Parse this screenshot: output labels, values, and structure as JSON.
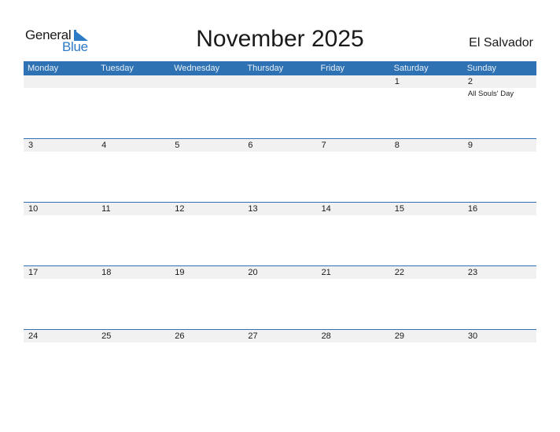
{
  "logo": {
    "word1": "General",
    "word2": "Blue",
    "brand_color": "#2c7bc4"
  },
  "title": "November 2025",
  "country": "El Salvador",
  "header_color": "#2e72b3",
  "days_of_week": [
    "Monday",
    "Tuesday",
    "Wednesday",
    "Thursday",
    "Friday",
    "Saturday",
    "Sunday"
  ],
  "weeks": [
    [
      {
        "day": ""
      },
      {
        "day": ""
      },
      {
        "day": ""
      },
      {
        "day": ""
      },
      {
        "day": ""
      },
      {
        "day": "1"
      },
      {
        "day": "2",
        "event": "All Souls' Day"
      }
    ],
    [
      {
        "day": "3"
      },
      {
        "day": "4"
      },
      {
        "day": "5"
      },
      {
        "day": "6"
      },
      {
        "day": "7"
      },
      {
        "day": "8"
      },
      {
        "day": "9"
      }
    ],
    [
      {
        "day": "10"
      },
      {
        "day": "11"
      },
      {
        "day": "12"
      },
      {
        "day": "13"
      },
      {
        "day": "14"
      },
      {
        "day": "15"
      },
      {
        "day": "16"
      }
    ],
    [
      {
        "day": "17"
      },
      {
        "day": "18"
      },
      {
        "day": "19"
      },
      {
        "day": "20"
      },
      {
        "day": "21"
      },
      {
        "day": "22"
      },
      {
        "day": "23"
      }
    ],
    [
      {
        "day": "24"
      },
      {
        "day": "25"
      },
      {
        "day": "26"
      },
      {
        "day": "27"
      },
      {
        "day": "28"
      },
      {
        "day": "29"
      },
      {
        "day": "30"
      }
    ]
  ]
}
